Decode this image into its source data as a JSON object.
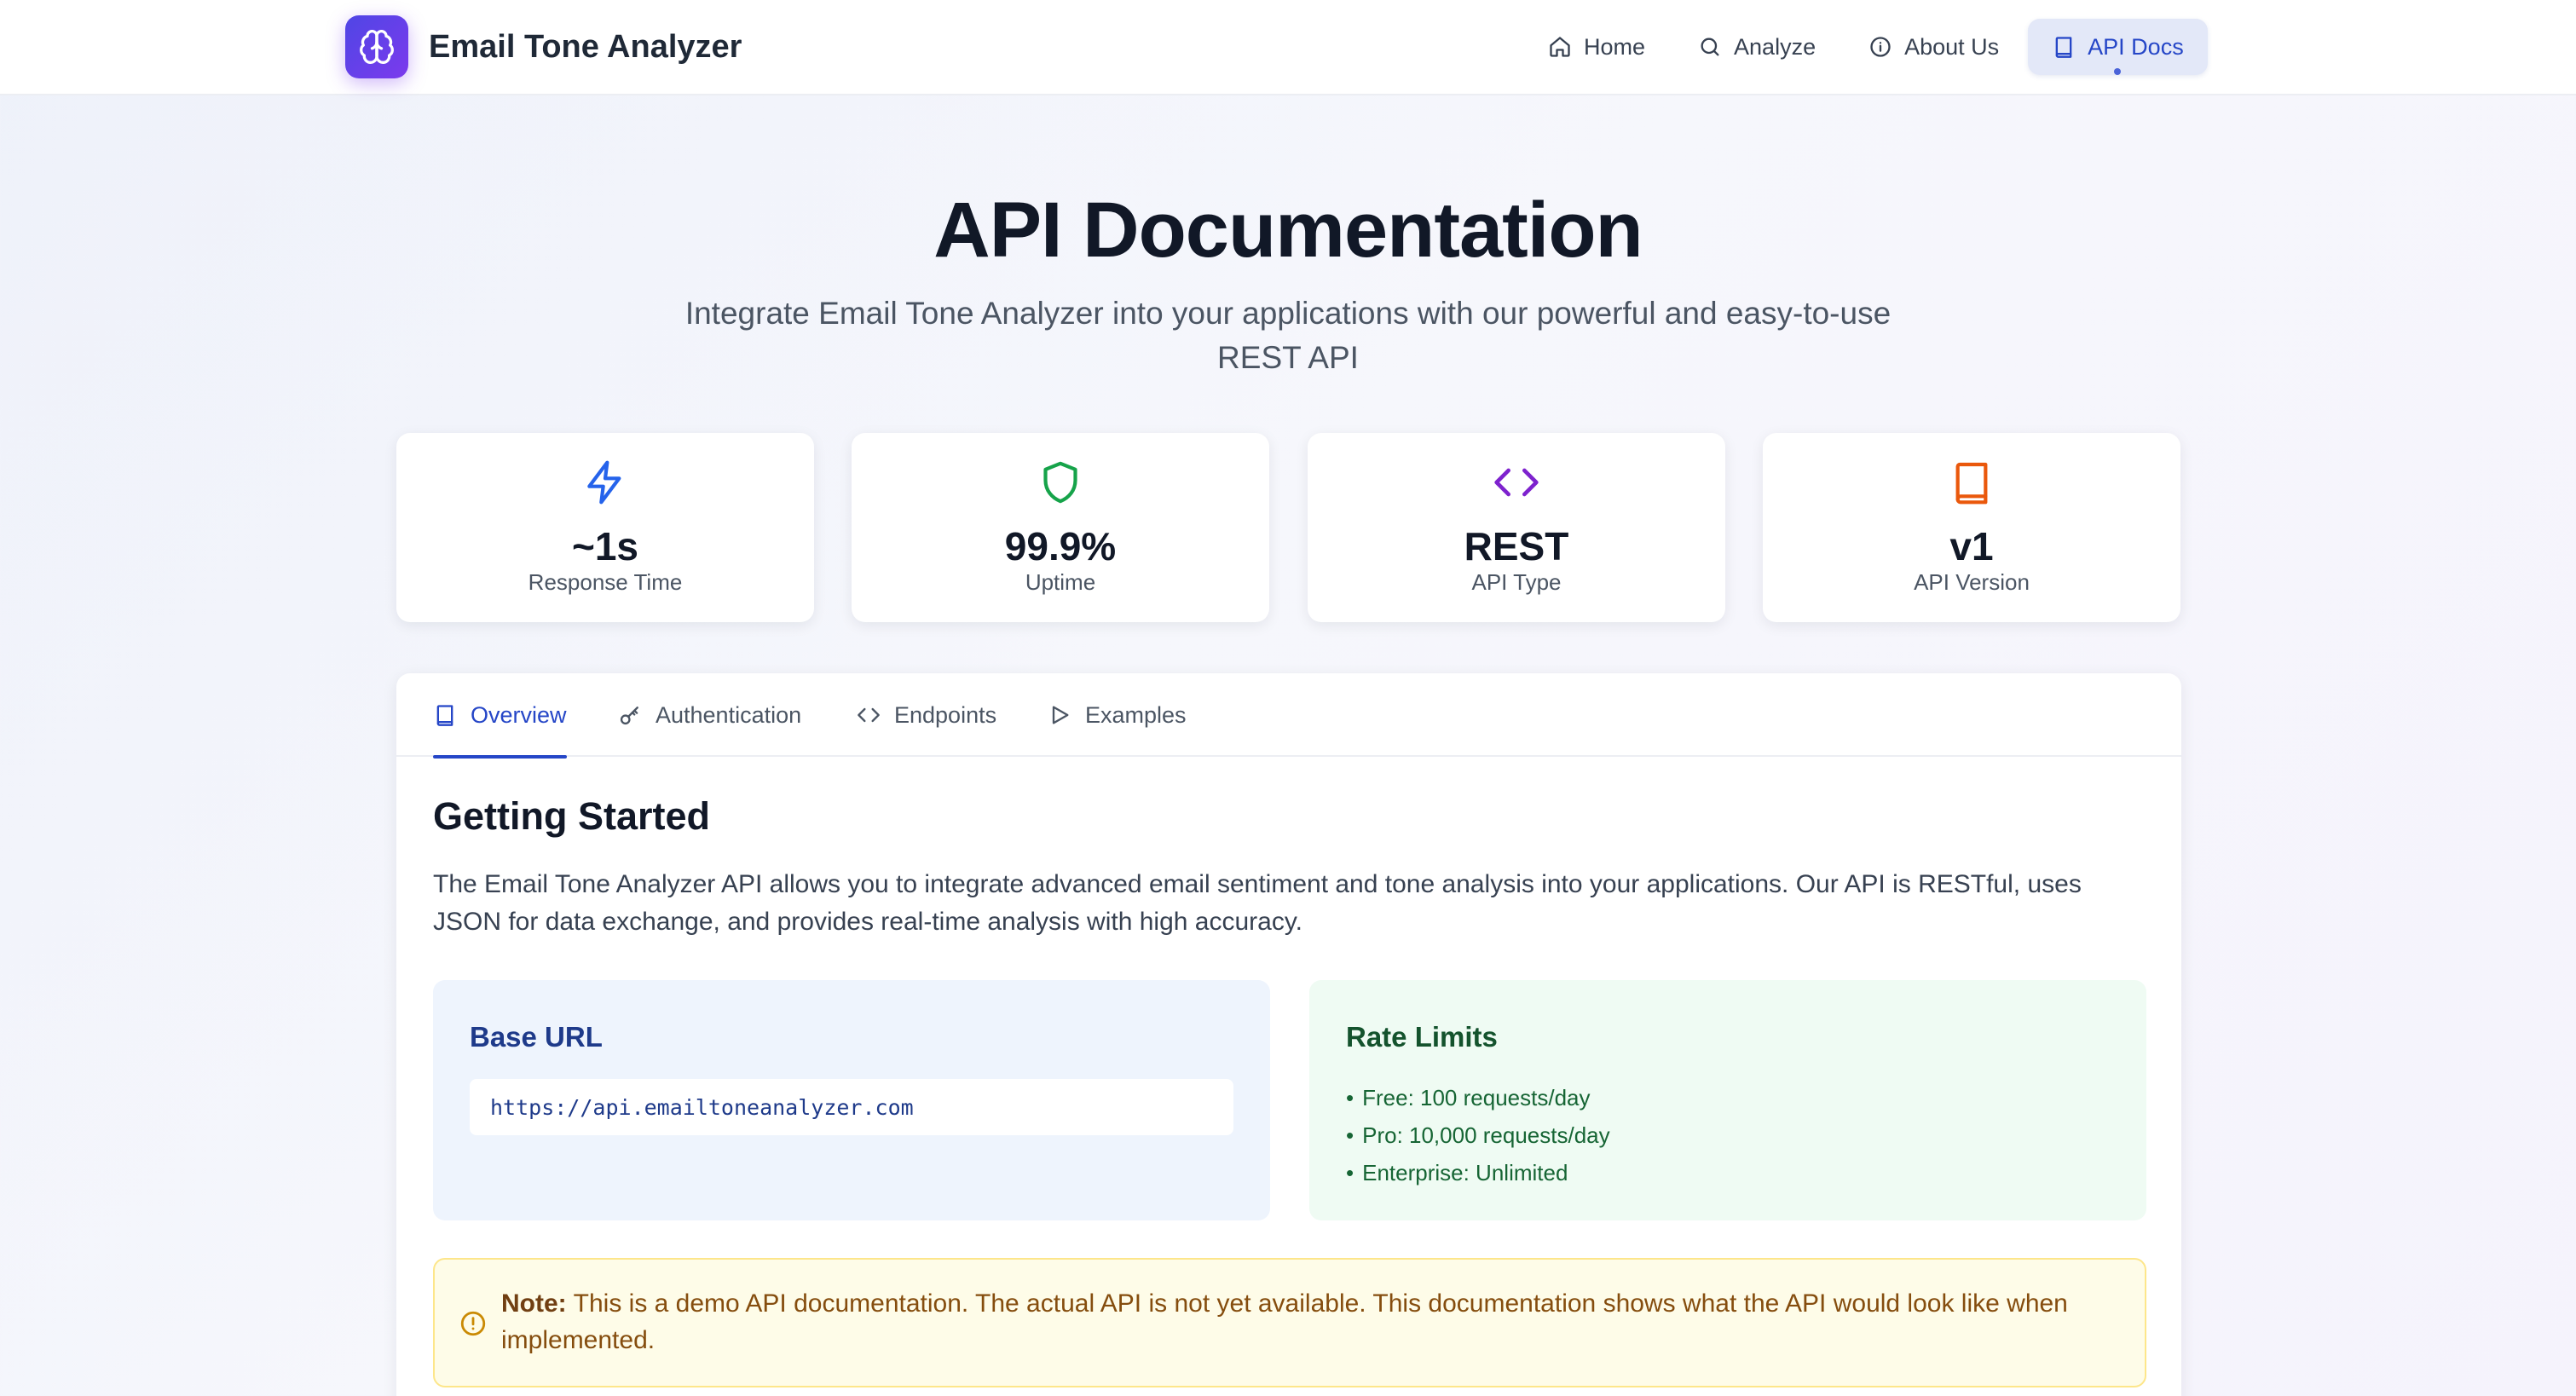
{
  "app": {
    "name": "Email Tone Analyzer",
    "logo_icon": "brain-icon"
  },
  "nav": {
    "items": [
      {
        "label": "Home",
        "icon": "home-icon"
      },
      {
        "label": "Analyze",
        "icon": "search-icon"
      },
      {
        "label": "About Us",
        "icon": "info-icon"
      },
      {
        "label": "API Docs",
        "icon": "book-icon",
        "active": true
      }
    ]
  },
  "hero": {
    "title": "API Documentation",
    "subtitle": "Integrate Email Tone Analyzer into your applications with our powerful and easy-to-use REST API"
  },
  "stats": [
    {
      "value": "~1s",
      "label": "Response Time",
      "icon": "zap-icon",
      "color": "#2563eb"
    },
    {
      "value": "99.9%",
      "label": "Uptime",
      "icon": "shield-icon",
      "color": "#16a34a"
    },
    {
      "value": "REST",
      "label": "API Type",
      "icon": "code-icon",
      "color": "#7e22ce"
    },
    {
      "value": "v1",
      "label": "API Version",
      "icon": "book-icon",
      "color": "#ea580c"
    }
  ],
  "tabs": [
    {
      "label": "Overview",
      "icon": "book-icon",
      "active": true
    },
    {
      "label": "Authentication",
      "icon": "key-icon"
    },
    {
      "label": "Endpoints",
      "icon": "code-icon"
    },
    {
      "label": "Examples",
      "icon": "play-icon"
    }
  ],
  "overview": {
    "title": "Getting Started",
    "body": "The Email Tone Analyzer API allows you to integrate advanced email sentiment and tone analysis into your applications. Our API is RESTful, uses JSON for data exchange, and provides real-time analysis with high accuracy.",
    "base_url": {
      "title": "Base URL",
      "url": "https://api.emailtoneanalyzer.com"
    },
    "rate_limits": {
      "title": "Rate Limits",
      "items": [
        "Free: 100 requests/day",
        "Pro: 10,000 requests/day",
        "Enterprise: Unlimited"
      ]
    },
    "note": {
      "label": "Note:",
      "text": "This is a demo API documentation. The actual API is not yet available. This documentation shows what the API would look like when implemented."
    }
  },
  "colors": {
    "accent": "#2546c7",
    "brand_gradient_start": "#4f46e5",
    "brand_gradient_end": "#7c3aed"
  }
}
